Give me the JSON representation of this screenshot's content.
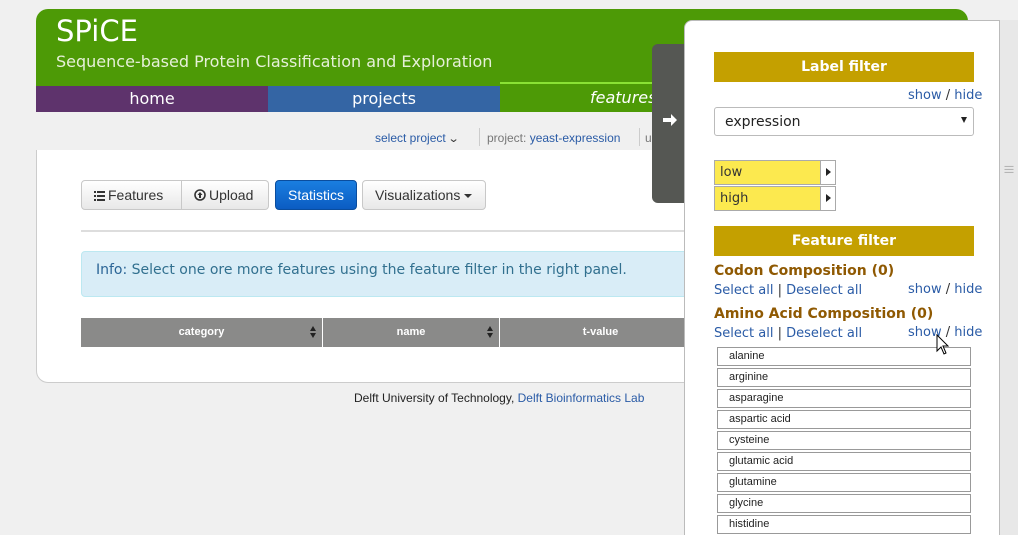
{
  "header": {
    "title": "SPiCE",
    "subtitle": "Sequence-based Protein Classification and Exploration",
    "nav": [
      {
        "label": "home"
      },
      {
        "label": "projects"
      },
      {
        "label": "features"
      }
    ]
  },
  "subbar": {
    "select_project": "select project",
    "project_prefix": "project:",
    "project_name": "yeast-expression",
    "user_fragment": "u"
  },
  "toolbar": {
    "features_label": "Features",
    "upload_label": "Upload",
    "statistics_label": "Statistics",
    "visualizations_label": "Visualizations"
  },
  "info": {
    "prefix": "Info:",
    "message": "Select one ore more features using the feature filter in the right panel."
  },
  "table": {
    "columns": [
      "category",
      "name",
      "t-value"
    ]
  },
  "footer": {
    "text": "Delft University of Technology,",
    "link": "Delft Bioinformatics Lab"
  },
  "side_panel": {
    "label_filter": {
      "title": "Label filter",
      "show": "show",
      "hide": "hide",
      "selected": "expression",
      "labels": [
        "low",
        "high"
      ]
    },
    "feature_filter": {
      "title": "Feature filter",
      "sections": [
        {
          "title": "Codon Composition (0)",
          "select_all": "Select all",
          "deselect_all": "Deselect all",
          "show": "show",
          "hide": "hide"
        },
        {
          "title": "Amino Acid Composition (0)",
          "select_all": "Select all",
          "deselect_all": "Deselect all",
          "show": "show",
          "hide": "hide"
        }
      ],
      "amino_acids": [
        "alanine",
        "arginine",
        "asparagine",
        "aspartic acid",
        "cysteine",
        "glutamic acid",
        "glutamine",
        "glycine",
        "histidine"
      ]
    }
  },
  "colors": {
    "header_green": "#4d9a06",
    "home_purple": "#5e336c",
    "projects_blue": "#3465a4",
    "filter_gold": "#c4a000",
    "label_yellow": "#fce94f",
    "primary_button": "#0b5cc2"
  }
}
